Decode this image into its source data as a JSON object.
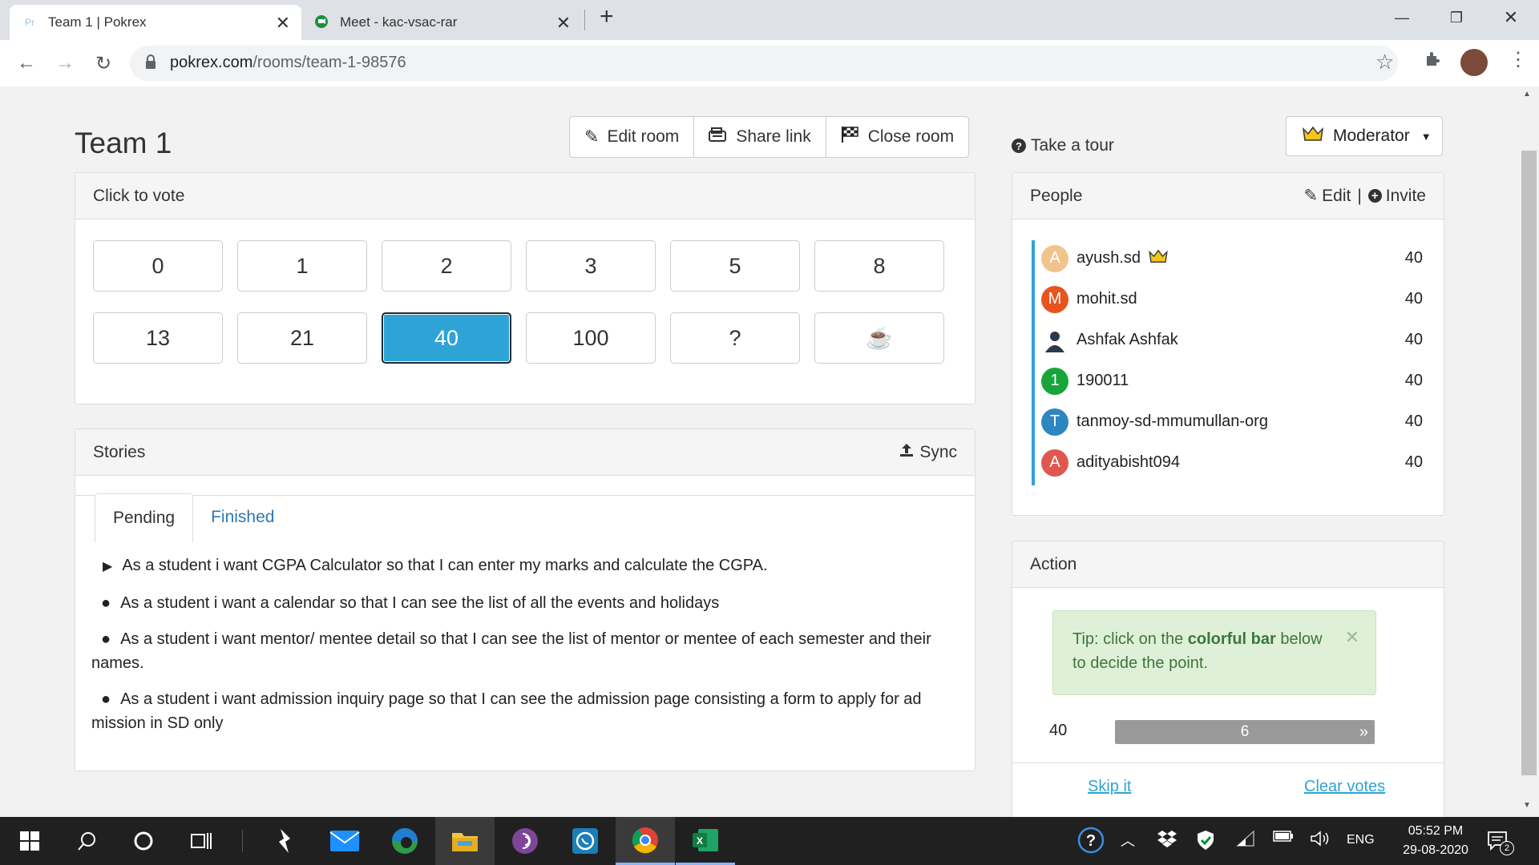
{
  "browser": {
    "tabs": [
      {
        "title": "Team 1 | Pokrex",
        "favicon": "Pr"
      },
      {
        "title": "Meet - kac-vsac-rar",
        "favicon": "meet-icon"
      }
    ],
    "url_domain": "pokrex.com",
    "url_path": "/rooms/team-1-98576"
  },
  "room": {
    "title": "Team 1",
    "edit_label": "Edit room",
    "share_label": "Share link",
    "close_label": "Close room",
    "tour_label": "Take a tour",
    "role_label": "Moderator"
  },
  "vote": {
    "heading": "Click to vote",
    "cards": [
      "0",
      "1",
      "2",
      "3",
      "5",
      "8",
      "13",
      "21",
      "40",
      "100",
      "?",
      "☕"
    ],
    "selected": "40"
  },
  "stories": {
    "heading": "Stories",
    "sync_label": "Sync",
    "tabs": [
      "Pending",
      "Finished"
    ],
    "active_tab": "Pending",
    "items": [
      "As a student i want CGPA Calculator so that I can enter my marks and calculate the CGPA.",
      "As a student i want a calendar so that I can see the list of all the events and holidays",
      "As a student i want mentor/ mentee detail so that I can see the list of mentor or mentee of each semester and their names.",
      "As a student i want admission inquiry page so that I can see the admission page consisting a form to apply for ad mission in SD only"
    ]
  },
  "people": {
    "heading": "People",
    "edit_label": "Edit",
    "separator": "|",
    "invite_label": "Invite",
    "list": [
      {
        "initial": "A",
        "name": "ayush.sd",
        "vote": "40",
        "color": "#f2c48d",
        "moderator": true
      },
      {
        "initial": "M",
        "name": "mohit.sd",
        "vote": "40",
        "color": "#e8541e"
      },
      {
        "initial": "",
        "name": "Ashfak Ashfak",
        "vote": "40",
        "color": "#2b3a4a"
      },
      {
        "initial": "1",
        "name": "190011",
        "vote": "40",
        "color": "#17a53a"
      },
      {
        "initial": "T",
        "name": "tanmoy-sd-mmumullan-org",
        "vote": "40",
        "color": "#2e86c1"
      },
      {
        "initial": "A",
        "name": "adityabisht094",
        "vote": "40",
        "color": "#e0574f"
      }
    ]
  },
  "action": {
    "heading": "Action",
    "tip_prefix": "Tip: click on the ",
    "tip_bold": "colorful bar",
    "tip_suffix": " below to decide the point.",
    "bar_value": "40",
    "bar_count": "6",
    "skip_label": "Skip it",
    "clear_label": "Clear votes"
  },
  "taskbar": {
    "time": "05:52 PM",
    "date": "29-08-2020",
    "lang": "ENG",
    "notif_count": "2"
  }
}
